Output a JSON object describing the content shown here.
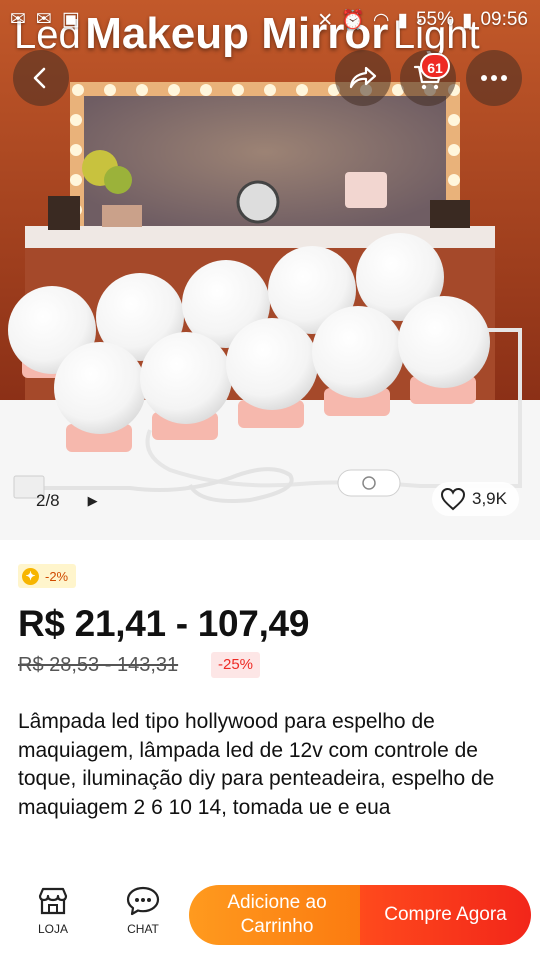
{
  "status_bar": {
    "battery": "55%",
    "time": "09:56"
  },
  "hero": {
    "title_prefix": "Led",
    "title_main": "Makeup Mirror",
    "title_suffix": "Light",
    "cart_count": "61",
    "image_counter": "2/8",
    "likes": "3,9K"
  },
  "coins": {
    "label": "-2%"
  },
  "product": {
    "price": "R$ 21,41 - 107,49",
    "original_price": "R$ 28,53 - 143,31",
    "discount": "-25%",
    "title": "Lâmpada led tipo hollywood para espelho de maquiagem, lâmpada led de 12v com controle de toque, iluminação diy para penteadeira, espelho de maquiagem 2 6 10 14, tomada ue e eua"
  },
  "bottom_bar": {
    "store_label": "LOJA",
    "chat_label": "CHAT",
    "add_to_cart_line1": "Adicione ao",
    "add_to_cart_line2": "Carrinho",
    "buy_now_label": "Compre Agora"
  },
  "colors": {
    "buy_button": "#f2261a",
    "cart_button": "#fb7a10",
    "discount_text": "#ee2a24",
    "cart_badge": "#ee2a24"
  },
  "icons": [
    "back-arrow-icon",
    "share-icon",
    "cart-icon",
    "more-icon",
    "play-icon",
    "heart-icon",
    "store-icon",
    "chat-icon",
    "coin-icon"
  ]
}
